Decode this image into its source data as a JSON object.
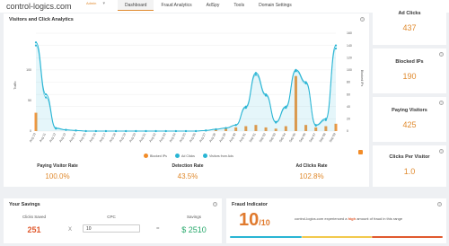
{
  "brand": "control-logics.com",
  "site_selector": "Admin",
  "nav": [
    {
      "label": "Dashboard",
      "active": true
    },
    {
      "label": "Fraud Analytics",
      "active": false
    },
    {
      "label": "AdSpy",
      "active": false
    },
    {
      "label": "Tools",
      "active": false
    },
    {
      "label": "Domain Settings",
      "active": false
    }
  ],
  "analytics": {
    "title": "Visitors and Click Analytics",
    "left_axis_label": "Traffic",
    "right_axis_label": "Blocked IPs",
    "legend": [
      "Blocked IPs",
      "Ad Clicks",
      "Visitors from Ads"
    ],
    "stats": [
      {
        "label": "Paying Visitor Rate",
        "value": "100.0%"
      },
      {
        "label": "Detection Rate",
        "value": "43.5%"
      },
      {
        "label": "Ad Clicks Rate",
        "value": "102.8%"
      }
    ]
  },
  "chart_data": {
    "type": "line",
    "x": [
      "Aug 10",
      "Aug 11",
      "Aug 12",
      "Aug 13",
      "Aug 14",
      "Aug 15",
      "Aug 16",
      "Aug 17",
      "Aug 18",
      "Aug 19",
      "Aug 20",
      "Aug 21",
      "Aug 22",
      "Aug 23",
      "Aug 24",
      "Aug 25",
      "Aug 26",
      "Aug 27",
      "Aug 28",
      "Aug 29",
      "Aug 30",
      "Aug 31",
      "Sep 01",
      "Sep 02",
      "Sep 03",
      "Sep 04",
      "Sep 05",
      "Sep 06",
      "Sep 07",
      "Sep 08",
      "Sep 09"
    ],
    "y_left_ticks": [
      0,
      50,
      100
    ],
    "y_right_ticks": [
      0,
      20,
      40,
      60,
      80,
      100,
      120,
      140,
      160
    ],
    "ylim_left": [
      0,
      160
    ],
    "ylim_right": [
      0,
      160
    ],
    "series": [
      {
        "name": "Ad Clicks",
        "color": "#29b5d4",
        "values": [
          145,
          60,
          5,
          2,
          1,
          0,
          0,
          0,
          0,
          0,
          0,
          0,
          0,
          0,
          0,
          0,
          0,
          1,
          3,
          5,
          10,
          40,
          95,
          60,
          15,
          40,
          100,
          80,
          10,
          20,
          140
        ]
      },
      {
        "name": "Visitors from Ads",
        "color": "#29b5d4",
        "values": [
          140,
          55,
          4,
          2,
          1,
          0,
          0,
          0,
          0,
          0,
          0,
          0,
          0,
          0,
          0,
          0,
          0,
          1,
          3,
          5,
          10,
          38,
          92,
          58,
          14,
          38,
          98,
          78,
          9,
          18,
          135
        ]
      },
      {
        "name": "Blocked IPs",
        "color": "#f28c28",
        "values": [
          30,
          0,
          0,
          0,
          0,
          0,
          0,
          0,
          0,
          0,
          0,
          0,
          0,
          0,
          0,
          0,
          0,
          0,
          2,
          4,
          6,
          8,
          10,
          6,
          4,
          8,
          90,
          10,
          6,
          8,
          12
        ]
      }
    ]
  },
  "side_cards": [
    {
      "label": "Ad Clicks",
      "value": "437"
    },
    {
      "label": "Blocked IPs",
      "value": "190"
    },
    {
      "label": "Paying Visitors",
      "value": "425"
    },
    {
      "label": "Clicks Per Visitor",
      "value": "1.0"
    }
  ],
  "savings": {
    "title": "Your Savings",
    "clicks_saved_label": "Clicks Saved",
    "clicks_saved_value": "251",
    "times": "X",
    "cpc_label": "CPC",
    "cpc_value": "10",
    "equals": "=",
    "savings_label": "Savings",
    "savings_value": "$ 2510"
  },
  "fraud": {
    "title": "Fraud Indicator",
    "score": "10",
    "max": "/10",
    "text_prefix": "control-logics.com experienced a",
    "text_highlight": "high",
    "text_suffix": "amount of fraud in this range",
    "colors": [
      "#29b5d4",
      "#f2c94c",
      "#e05a2e"
    ]
  }
}
